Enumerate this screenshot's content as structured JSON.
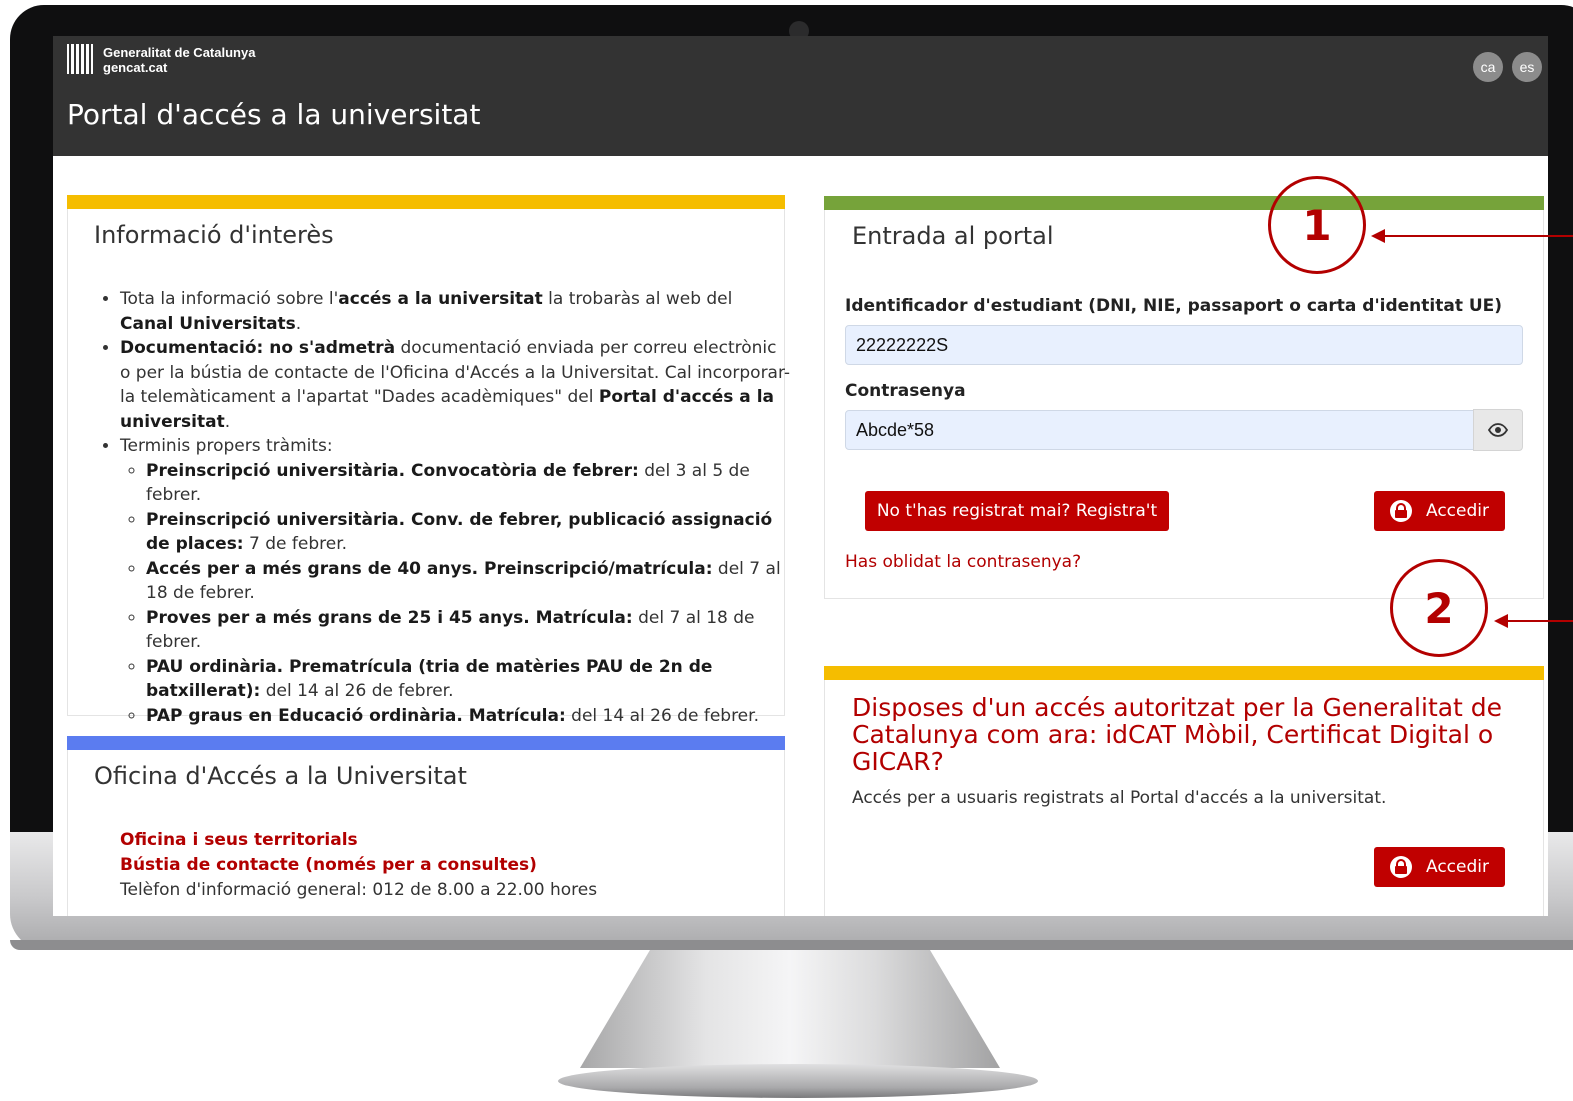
{
  "header": {
    "org_name": "Generalitat de Catalunya",
    "org_domain": "gencat.cat",
    "languages": [
      "ca",
      "es"
    ],
    "title": "Portal d'accés a la universitat"
  },
  "info": {
    "title": "Informació d'interès",
    "bullet1": {
      "t1": "Tota la informació sobre l'",
      "b1": "accés a la universitat",
      "t2": " la trobaràs al web del ",
      "link": "Canal Universitats",
      "t3": "."
    },
    "bullet2": {
      "b1": "Documentació: no s'admetrà",
      "t1": " documentació enviada per correu electrònic o per la bústia de contacte de l'Oficina d'Accés a la Universitat. Cal incorporar-la telemàticament a l'apartat \"Dades acadèmiques\" del ",
      "link": "Portal d'accés a la universitat",
      "t2": "."
    },
    "bullet3": "Terminis propers tràmits:",
    "deadlines": [
      {
        "label": "Preinscripció universitària. Convocatòria de febrer:",
        "date": " del 3 al 5 de febrer."
      },
      {
        "label": "Preinscripció universitària. Conv. de febrer, publicació assignació de places:",
        "date": " 7 de febrer."
      },
      {
        "label": "Accés per a més grans de 40 anys. Preinscripció/matrícula:",
        "date": " del 7 al 18 de febrer."
      },
      {
        "label": "Proves per a més grans de 25 i 45 anys. Matrícula:",
        "date": " del 7 al 18 de febrer."
      },
      {
        "label": "PAU ordinària. Prematrícula (tria de matèries PAU de 2n de batxillerat):",
        "date": " del 14 al 26 de febrer."
      },
      {
        "label": "PAP graus en Educació ordinària. Matrícula:",
        "date": " del 14 al 26 de febrer."
      }
    ]
  },
  "office": {
    "title": "Oficina d'Accés a la Universitat",
    "link1": "Oficina i seus territorials",
    "link2": "Bústia de contacte (només per a consultes)",
    "phone": "Telèfon d'informació general: 012 de 8.00 a 22.00 hores"
  },
  "login": {
    "title": "Entrada al portal",
    "id_label": "Identificador d'estudiant (DNI, NIE, passaport o carta d'identitat UE)",
    "id_value": "22222222S",
    "password_label": "Contrasenya",
    "password_value": "Abcde*58",
    "register_button": "No t'has registrat mai? Registra't",
    "login_button": "Accedir",
    "forgot_link": "Has oblidat la contrasenya?"
  },
  "auth": {
    "title": "Disposes d'un accés autoritzat per la Generalitat de Catalunya com ara: idCAT Mòbil, Certificat Digital o GICAR?",
    "description": "Accés per a usuaris registrats al Portal d'accés a la universitat.",
    "login_button": "Accedir"
  },
  "annotations": {
    "step1": "1",
    "step2": "2"
  },
  "colors": {
    "header": "#333333",
    "accent_red": "#c00000",
    "bar_info": "#f5bd00",
    "bar_office": "#5b7cf0",
    "bar_login": "#76a33a",
    "bar_auth": "#f5bd00"
  },
  "icons": [
    "gencat-logo-icon",
    "eye-icon",
    "lock-icon",
    "lock-icon",
    "arrow-left-icon"
  ]
}
